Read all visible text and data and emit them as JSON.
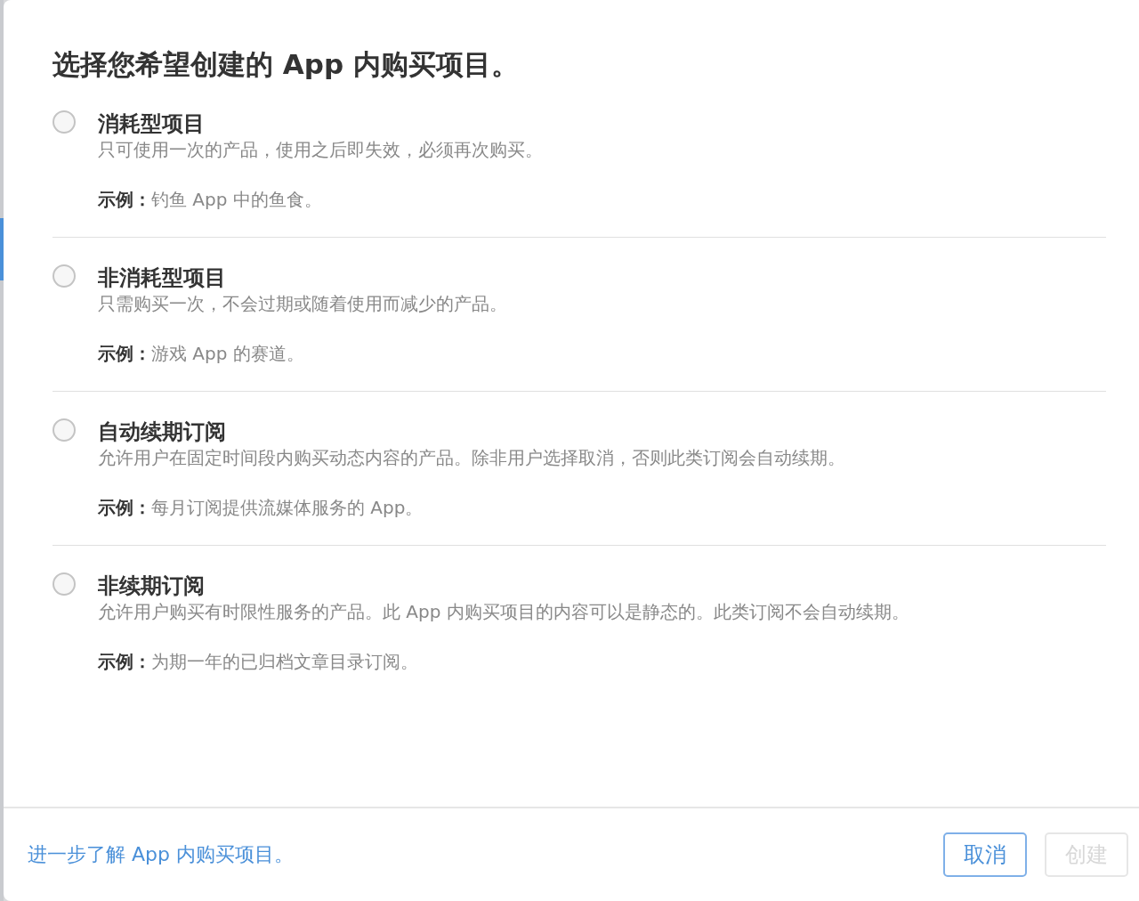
{
  "dialog": {
    "title": "选择您希望创建的 App 内购买项目。",
    "options": [
      {
        "name": "消耗型项目",
        "description": "只可使用一次的产品，使用之后即失效，必须再次购买。",
        "example": "**示例：**钓鱼 App 中的鱼食。",
        "selected": false
      },
      {
        "name": "非消耗型项目",
        "description": "只需购买一次，不会过期或随着使用而减少的产品。",
        "example": "**示例：**游戏 App 的赛道。",
        "selected": false
      },
      {
        "name": "自动续期订阅",
        "description": "允许用户在固定时间段内购买动态内容的产品。除非用户选择取消，否则此类订阅会自动续期。",
        "example": "**示例：**每月订阅提供流媒体服务的 App。",
        "selected": false
      },
      {
        "name": "非续期订阅",
        "description": "允许用户购买有时限性服务的产品。此 App 内购买项目的内容可以是静态的。此类订阅不会自动续期。",
        "example": "**示例：**为期一年的已归档文章目录订阅。",
        "selected": false
      }
    ],
    "footer": {
      "link": "进一步了解 App 内购买项目。",
      "buttons": [
        {
          "label": "取消",
          "disabled": false
        },
        {
          "label": "创建",
          "disabled": true
        }
      ]
    }
  }
}
